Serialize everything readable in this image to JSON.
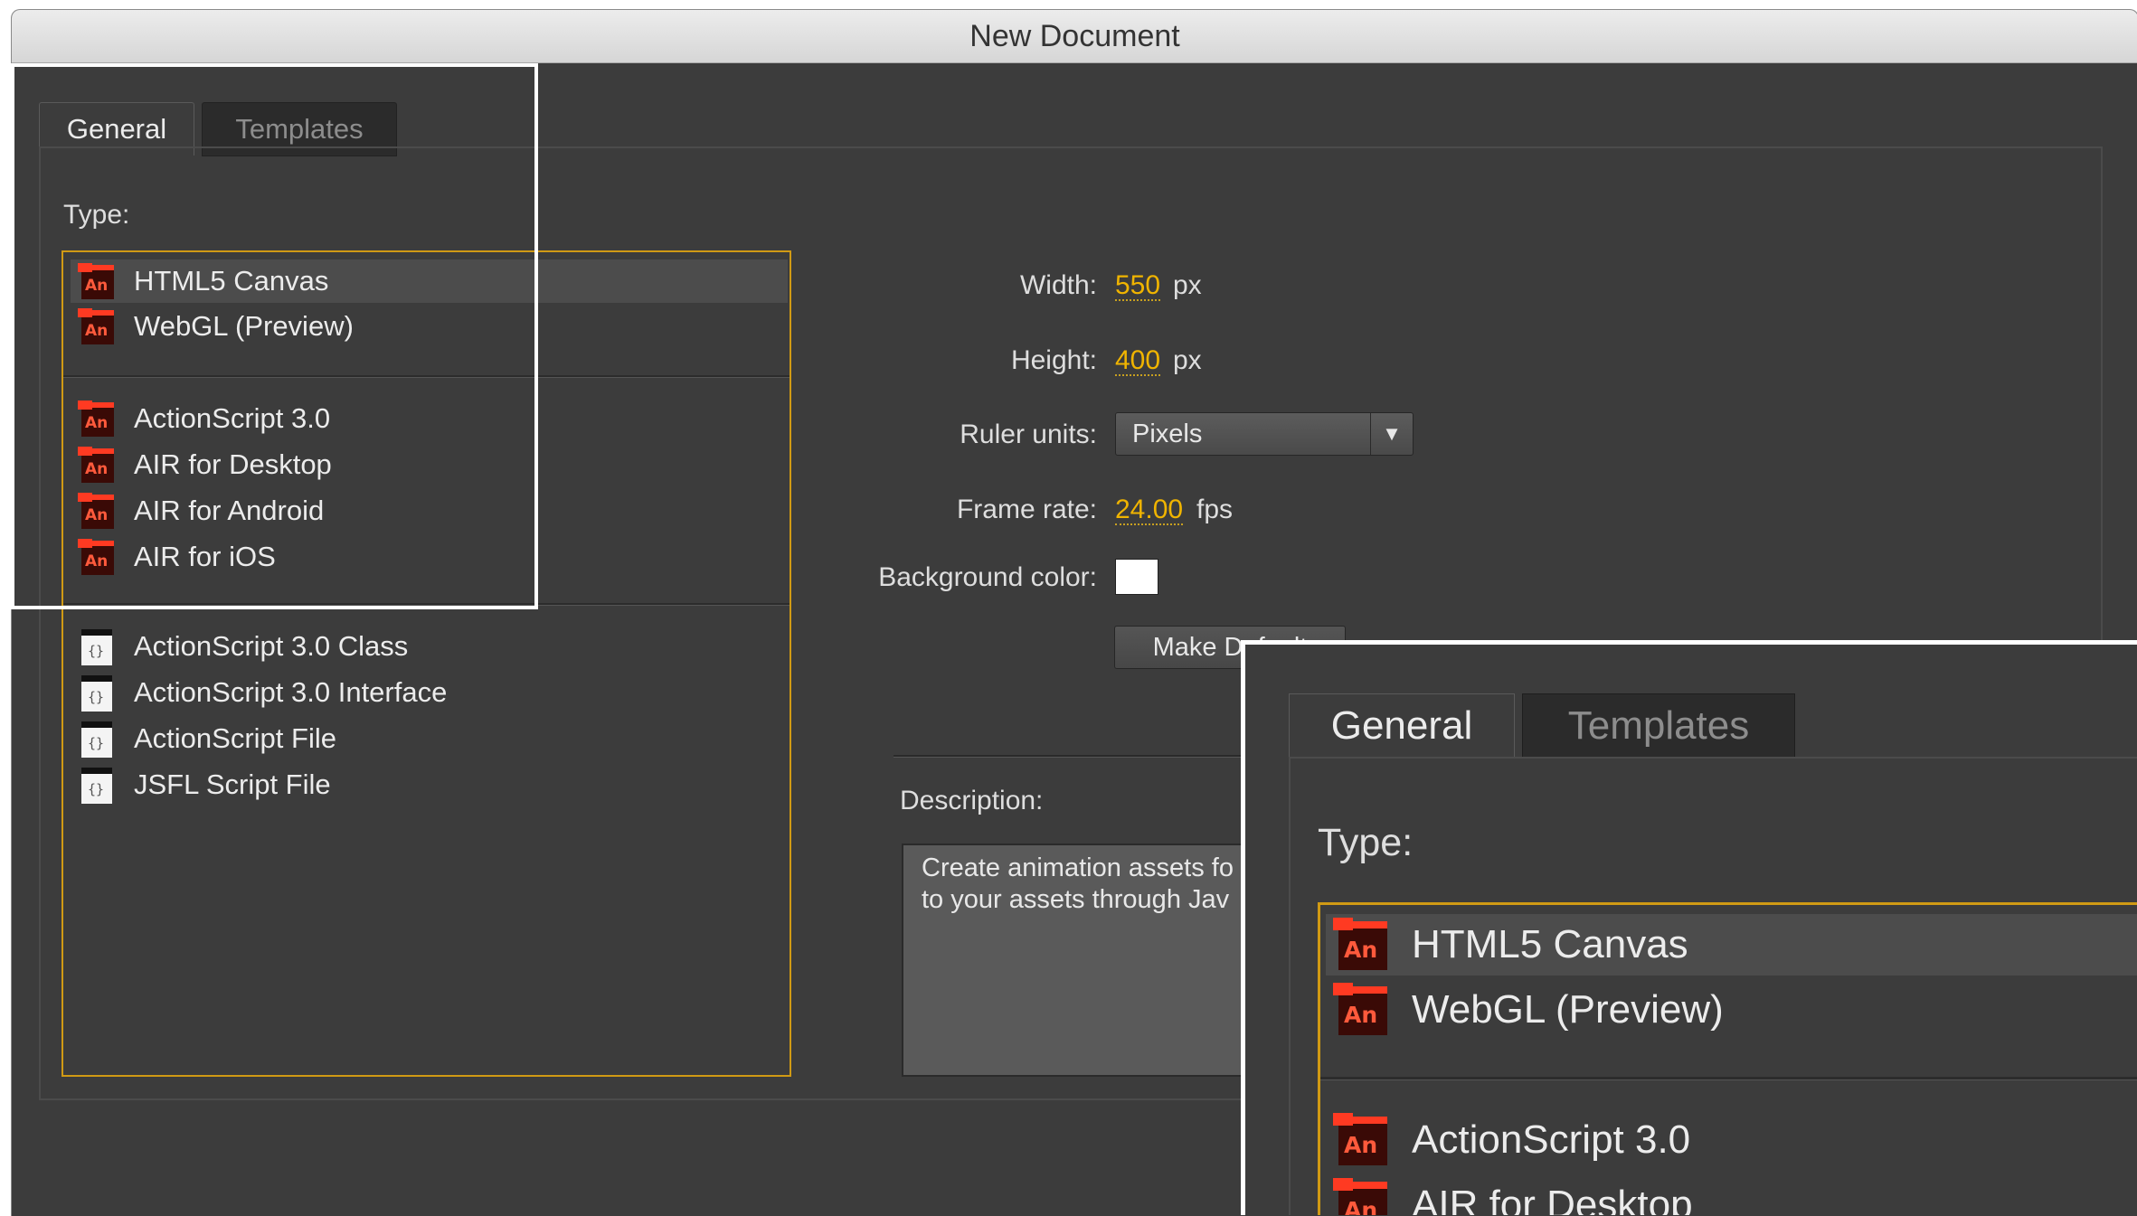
{
  "window": {
    "title": "New Document"
  },
  "tabs": [
    {
      "label": "General"
    },
    {
      "label": "Templates"
    }
  ],
  "type_label": "Type:",
  "type_list": {
    "group1": [
      {
        "label": "HTML5 Canvas",
        "icon": "animate-an-icon",
        "selected": true
      },
      {
        "label": "WebGL (Preview)",
        "icon": "animate-an-icon"
      }
    ],
    "group2": [
      {
        "label": "ActionScript 3.0",
        "icon": "animate-an-icon"
      },
      {
        "label": "AIR for Desktop",
        "icon": "animate-an-icon"
      },
      {
        "label": "AIR for Android",
        "icon": "animate-an-icon"
      },
      {
        "label": "AIR for iOS",
        "icon": "animate-an-icon"
      }
    ],
    "group3": [
      {
        "label": "ActionScript 3.0 Class",
        "icon": "script-file-icon"
      },
      {
        "label": "ActionScript 3.0 Interface",
        "icon": "script-file-icon"
      },
      {
        "label": "ActionScript File",
        "icon": "script-file-icon"
      },
      {
        "label": "JSFL Script File",
        "icon": "script-file-icon"
      }
    ]
  },
  "icon_text": "An",
  "doc_icon_text": "{}",
  "fields": {
    "width": {
      "label": "Width:",
      "value": "550",
      "unit": "px"
    },
    "height": {
      "label": "Height:",
      "value": "400",
      "unit": "px"
    },
    "ruler_units": {
      "label": "Ruler units:",
      "value": "Pixels",
      "arrow": "▼"
    },
    "frame_rate": {
      "label": "Frame rate:",
      "value": "24.00",
      "unit": "fps"
    },
    "background_color": {
      "label": "Background color:",
      "value": "#ffffff"
    }
  },
  "make_default_label": "Make Default",
  "description": {
    "label": "Description:",
    "line1": "Create animation assets fo",
    "line2": "to your assets through Jav"
  },
  "colors": {
    "accent": "#d09a14",
    "value_text": "#f0b400",
    "panel_bg": "#3c3c3c"
  },
  "zoom": {
    "tabs": [
      {
        "label": "General"
      },
      {
        "label": "Templates"
      }
    ],
    "type_label": "Type:",
    "items": [
      {
        "label": "HTML5 Canvas",
        "selected": true
      },
      {
        "label": "WebGL (Preview)"
      },
      {
        "label": "ActionScript 3.0"
      },
      {
        "label": "AIR for Desktop"
      }
    ]
  }
}
